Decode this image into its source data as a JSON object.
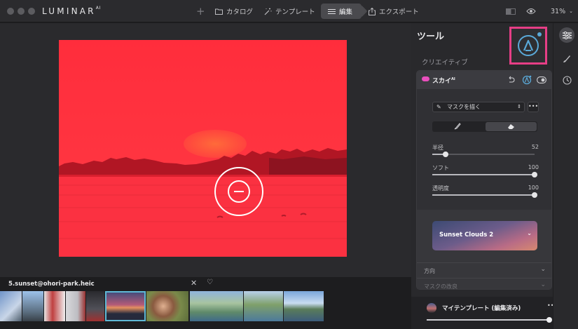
{
  "titlebar": {
    "logo": "LUMINAR",
    "logo_sup": "AI",
    "nav": {
      "catalog": "カタログ",
      "templates": "テンプレート",
      "edit": "編集",
      "export": "エクスポート"
    },
    "zoom": "31%"
  },
  "filmstrip": {
    "filename": "5.sunset@ohori-park.heic"
  },
  "panel": {
    "title": "ツール",
    "category": "クリエイティブ",
    "sky_tool": {
      "name": "スカイ",
      "name_sup": "AI",
      "mask_mode": "マスクを描く",
      "more": "•••",
      "sliders": [
        {
          "label": "半径",
          "value": "52",
          "fraction": 0.13
        },
        {
          "label": "ソフト",
          "value": "100",
          "fraction": 1.0
        },
        {
          "label": "透明度",
          "value": "100",
          "fraction": 1.0
        }
      ],
      "sky_selection": "Sunset Clouds 2",
      "sections": [
        {
          "label": "方向"
        },
        {
          "label": "マスクの改良"
        }
      ]
    },
    "my_template": {
      "label": "マイテンプレート (編集済み)",
      "more": "•••"
    }
  },
  "colors": {
    "accent": "#5aa9d8",
    "highlight": "#e63e86",
    "sky_icon": "#e94fbd",
    "photo_overlay": "#ff2d3c"
  }
}
